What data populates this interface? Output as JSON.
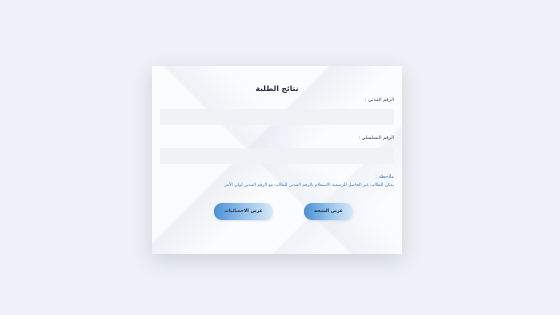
{
  "form": {
    "title": "نتائج الطلبة",
    "civil_id_label": "الرقم المدني :",
    "civil_id_value": "",
    "seat_no_label": "الرقم التسلسلي :",
    "seat_no_value": "",
    "note_title": "ملاحظة :",
    "note_text": "يمكن للطالب غير الحاصل للرسمية الاستعلام بالرقم المدني للطالب مع الرقم المدني لولي الأمر"
  },
  "buttons": {
    "show_result": "عرض النتيجة",
    "show_stats": "عرض الاحصائيات"
  },
  "colors": {
    "background": "#eef1f7",
    "accent": "#4a92d4",
    "note_text": "#3b7fb8"
  }
}
